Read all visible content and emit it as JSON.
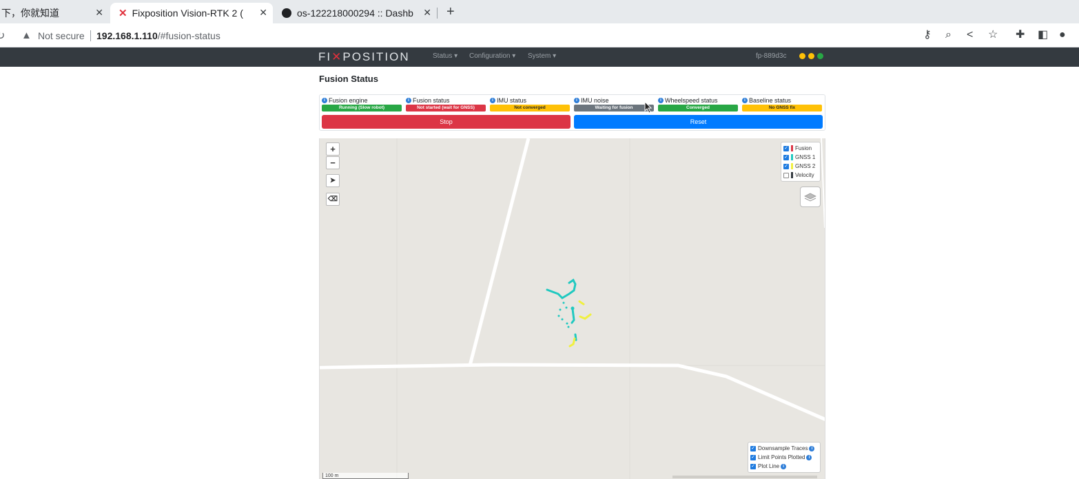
{
  "browser": {
    "tabs": [
      {
        "title": "下，你就知道"
      },
      {
        "title": "Fixposition Vision-RTK 2 (",
        "active": true
      },
      {
        "title": "os-122218000294 :: Dashb"
      }
    ],
    "new_tab": "+",
    "security": "Not secure",
    "url_host": "192.168.1.110",
    "url_path": "/#fusion-status"
  },
  "navbar": {
    "brand_pre": "FI",
    "brand_x": "✕",
    "brand_post": "POSITION",
    "menu": [
      "Status ▾",
      "Configuration ▾",
      "System ▾"
    ],
    "device": "fp-889d3c",
    "indicator_colors": [
      "#ffc107",
      "#ffc107",
      "#28a745"
    ]
  },
  "page": {
    "title": "Fusion Status"
  },
  "status": {
    "items": [
      {
        "label": "Fusion engine",
        "value": "Running (Slow robot)",
        "color": "green"
      },
      {
        "label": "Fusion status",
        "value": "Not started (wait for GNSS)",
        "color": "red"
      },
      {
        "label": "IMU status",
        "value": "Not converged",
        "color": "yellow"
      },
      {
        "label": "IMU noise",
        "value": "Waiting for fusion",
        "color": "gray"
      },
      {
        "label": "Wheelspeed status",
        "value": "Converged",
        "color": "green"
      },
      {
        "label": "Baseline status",
        "value": "No GNSS fix",
        "color": "yellow"
      }
    ],
    "stop_label": "Stop",
    "reset_label": "Reset"
  },
  "map": {
    "zoom_in": "+",
    "zoom_out": "−",
    "legend": [
      {
        "label": "Fusion",
        "checked": true,
        "color": "#dc3545"
      },
      {
        "label": "GNSS 1",
        "checked": true,
        "color": "#20c9c0"
      },
      {
        "label": "GNSS 2",
        "checked": true,
        "color": "#f0f040"
      },
      {
        "label": "Velocity",
        "checked": false,
        "color": "#343a40"
      }
    ],
    "options": [
      {
        "label": "Downsample Traces",
        "checked": true
      },
      {
        "label": "Limit Points Plotted",
        "checked": true
      },
      {
        "label": "Plot Line",
        "checked": true
      }
    ],
    "scale": "100 m"
  }
}
